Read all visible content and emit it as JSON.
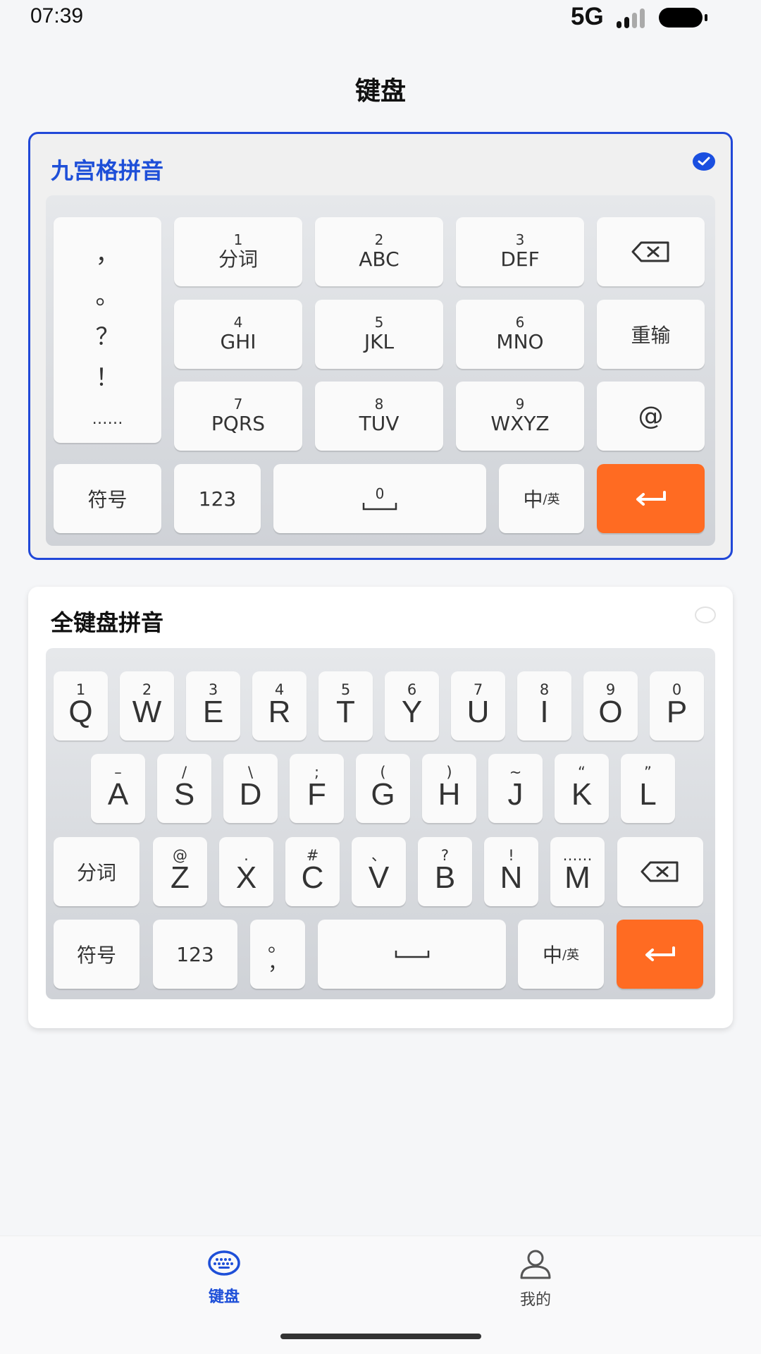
{
  "status_bar": {
    "time": "07:39",
    "network": "5G"
  },
  "page_title": "键盘",
  "t9": {
    "title": "九宫格拼音",
    "selected": true,
    "punctuation": [
      "，",
      "。",
      "？",
      "！",
      "……"
    ],
    "keys": [
      {
        "sup": "1",
        "main": "分词"
      },
      {
        "sup": "2",
        "main": "ABC"
      },
      {
        "sup": "3",
        "main": "DEF"
      },
      {
        "sup": "4",
        "main": "GHI"
      },
      {
        "sup": "5",
        "main": "JKL"
      },
      {
        "sup": "6",
        "main": "MNO"
      },
      {
        "sup": "7",
        "main": "PQRS"
      },
      {
        "sup": "8",
        "main": "TUV"
      },
      {
        "sup": "9",
        "main": "WXYZ"
      }
    ],
    "side_keys": {
      "reinput": "重输",
      "at": "@"
    },
    "bottom": {
      "symbol": "符号",
      "num": "123",
      "space_sup": "0",
      "lang_main": "中",
      "lang_sub": "/英"
    }
  },
  "full": {
    "title": "全键盘拼音",
    "selected": false,
    "row1": [
      {
        "sup": "1",
        "main": "Q"
      },
      {
        "sup": "2",
        "main": "W"
      },
      {
        "sup": "3",
        "main": "E"
      },
      {
        "sup": "4",
        "main": "R"
      },
      {
        "sup": "5",
        "main": "T"
      },
      {
        "sup": "6",
        "main": "Y"
      },
      {
        "sup": "7",
        "main": "U"
      },
      {
        "sup": "8",
        "main": "I"
      },
      {
        "sup": "9",
        "main": "O"
      },
      {
        "sup": "0",
        "main": "P"
      }
    ],
    "row2": [
      {
        "sup": "–",
        "main": "A"
      },
      {
        "sup": "/",
        "main": "S"
      },
      {
        "sup": "\\",
        "main": "D"
      },
      {
        "sup": ";",
        "main": "F"
      },
      {
        "sup": "(",
        "main": "G"
      },
      {
        "sup": ")",
        "main": "H"
      },
      {
        "sup": "~",
        "main": "J"
      },
      {
        "sup": "“",
        "main": "K"
      },
      {
        "sup": "”",
        "main": "L"
      }
    ],
    "row3": [
      {
        "sup": "@",
        "main": "Z"
      },
      {
        "sup": ".",
        "main": "X"
      },
      {
        "sup": "#",
        "main": "C"
      },
      {
        "sup": "、",
        "main": "V"
      },
      {
        "sup": "?",
        "main": "B"
      },
      {
        "sup": "!",
        "main": "N"
      },
      {
        "sup": "……",
        "main": "M"
      }
    ],
    "split": "分词",
    "bottom": {
      "symbol": "符号",
      "num": "123",
      "period": "。",
      "comma": "，",
      "lang_main": "中",
      "lang_sub": "/英"
    }
  },
  "tabs": [
    {
      "label": "键盘",
      "icon": "keyboard-icon",
      "active": true
    },
    {
      "label": "我的",
      "icon": "user-icon",
      "active": false
    }
  ],
  "colors": {
    "accent": "#1e4fd8",
    "enter_key": "#ff6b22"
  }
}
